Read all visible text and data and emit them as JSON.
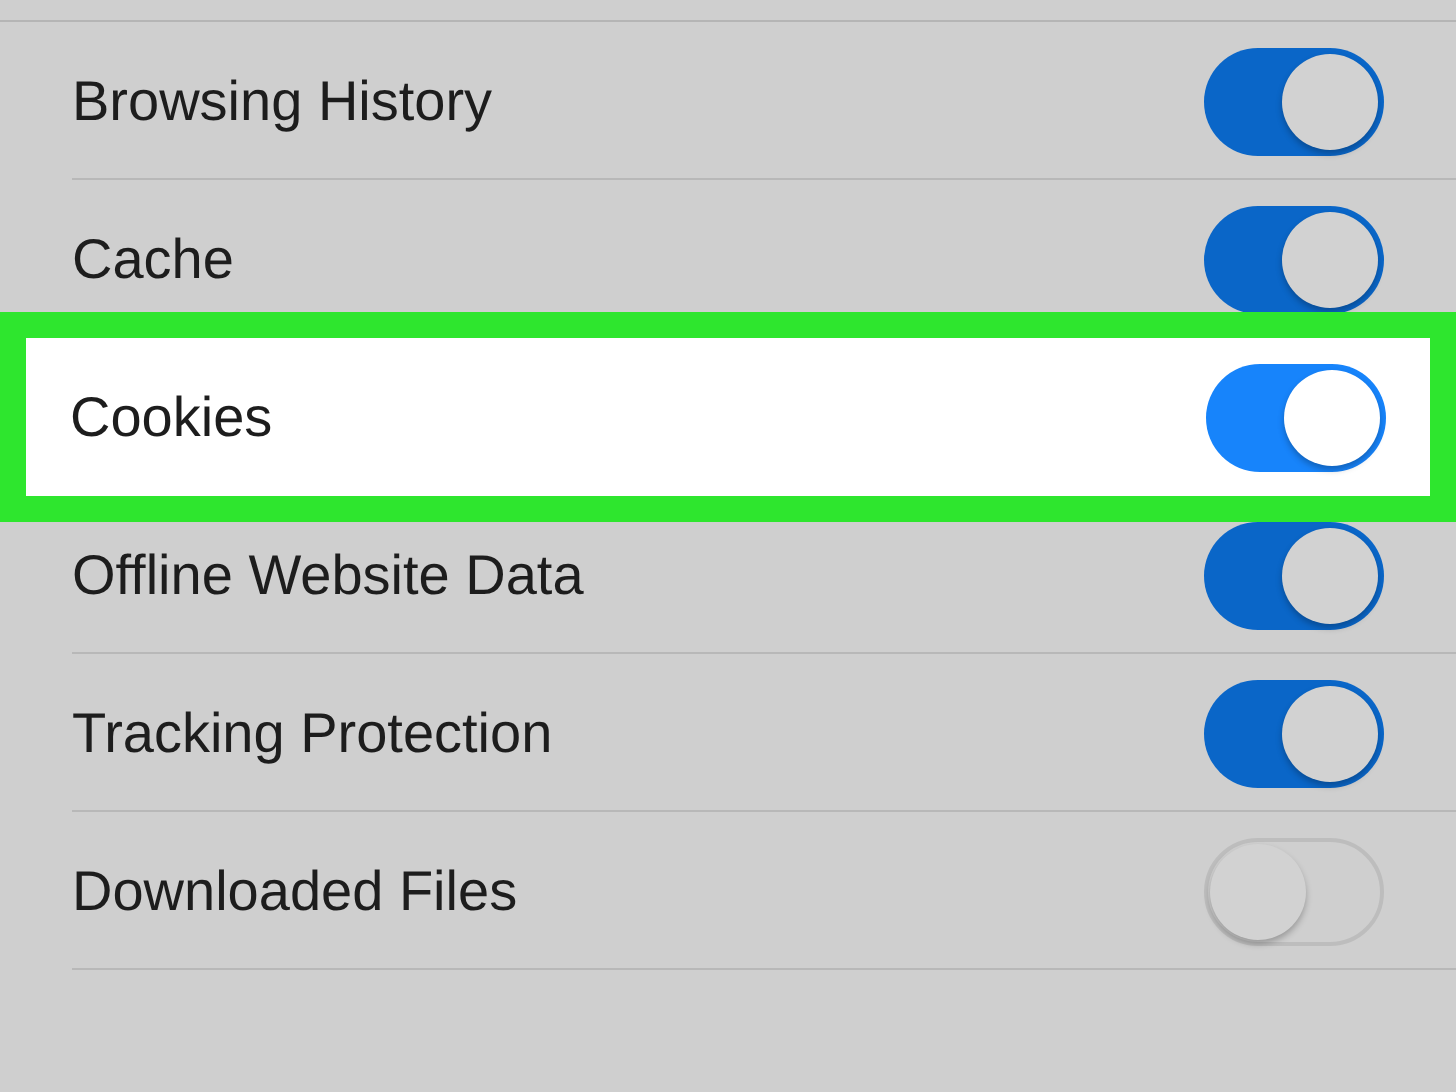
{
  "settings": [
    {
      "label": "Browsing History",
      "on": true,
      "highlighted": false
    },
    {
      "label": "Cache",
      "on": true,
      "highlighted": false
    },
    {
      "label": "Cookies",
      "on": true,
      "highlighted": true
    },
    {
      "label": "Offline Website Data",
      "on": true,
      "highlighted": false
    },
    {
      "label": "Tracking Protection",
      "on": true,
      "highlighted": false
    },
    {
      "label": "Downloaded Files",
      "on": false,
      "highlighted": false
    }
  ]
}
